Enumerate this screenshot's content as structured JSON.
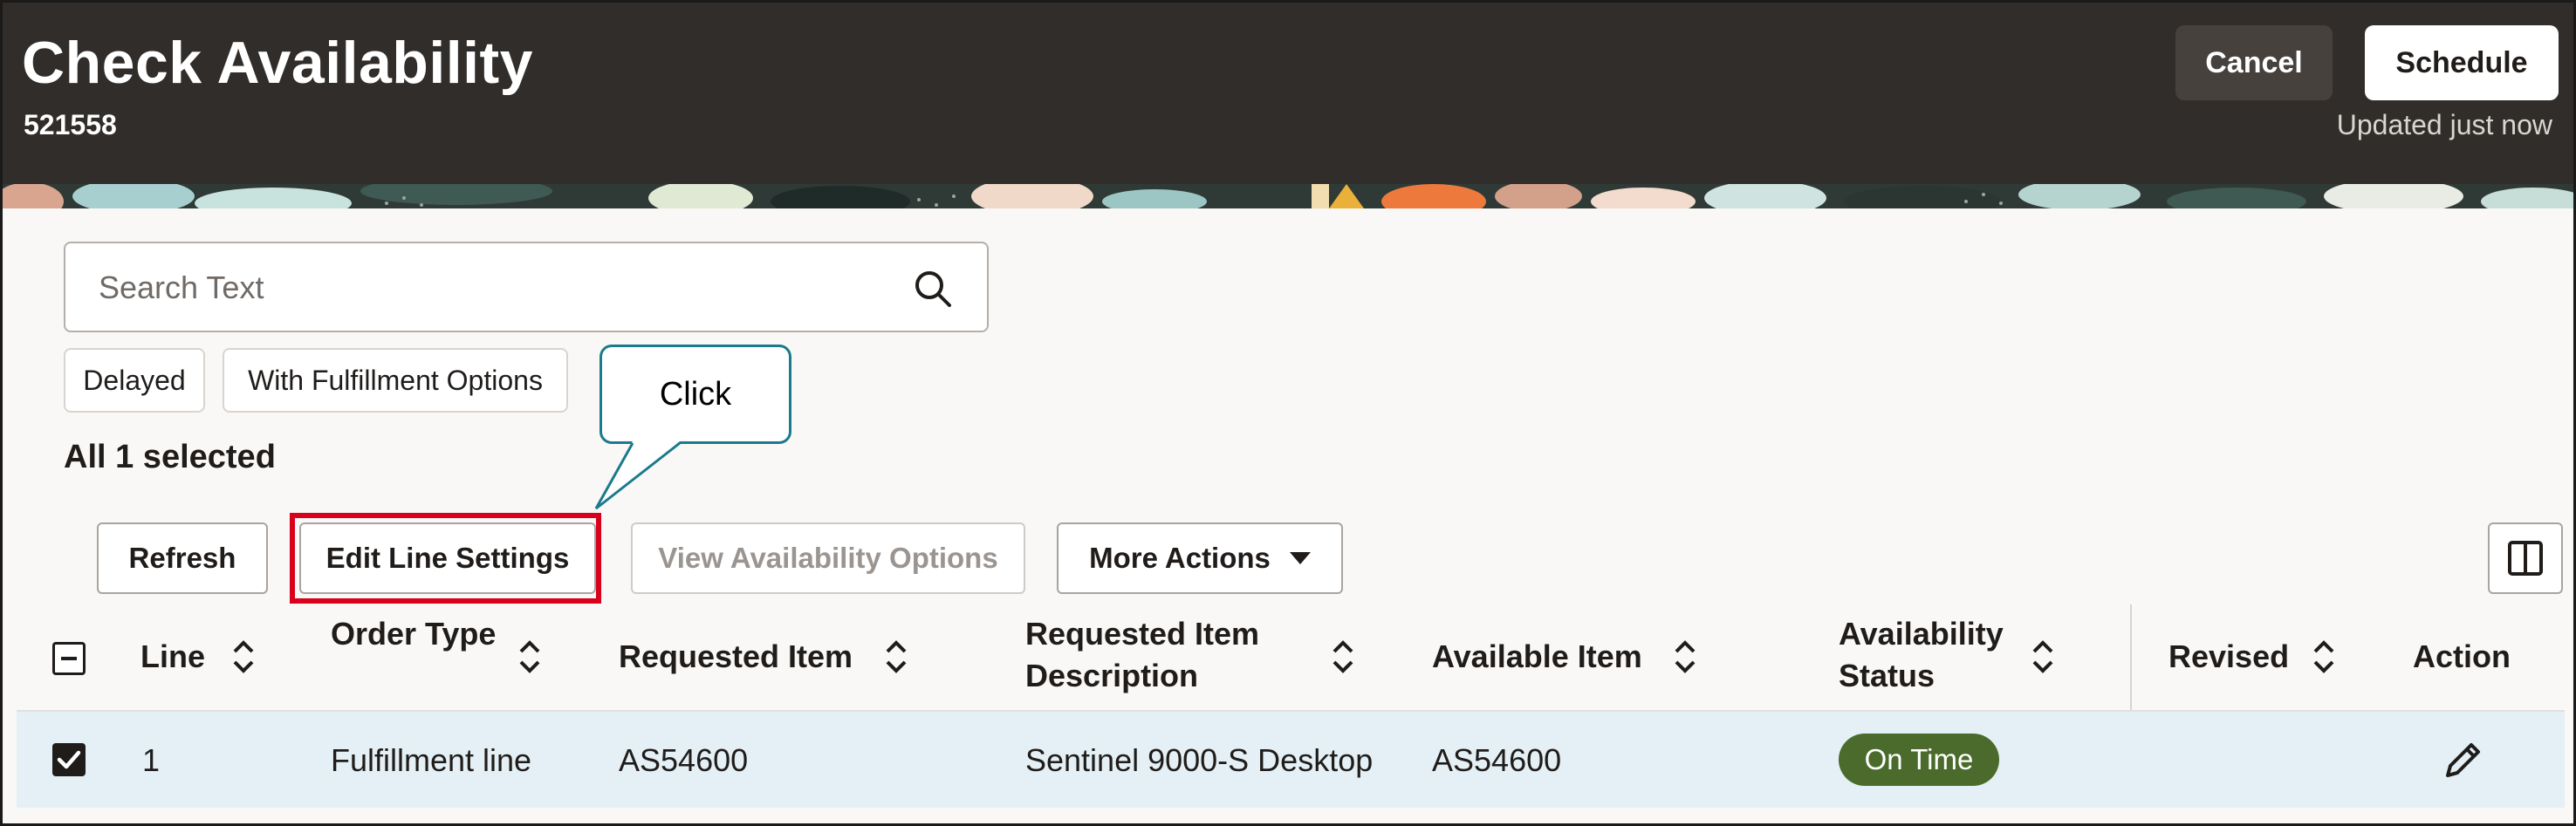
{
  "header": {
    "title": "Check Availability",
    "order_number": "521558",
    "cancel_label": "Cancel",
    "schedule_label": "Schedule",
    "updated_text": "Updated just now"
  },
  "search": {
    "placeholder": "Search Text",
    "icon": "search-icon"
  },
  "filters": [
    "Delayed",
    "With Fulfillment Options"
  ],
  "callout": {
    "text": "Click"
  },
  "selection_text": "All 1 selected",
  "toolbar": {
    "refresh_label": "Refresh",
    "edit_line_settings_label": "Edit Line Settings",
    "view_availability_label": "View Availability Options",
    "more_actions_label": "More Actions",
    "panel_icon": "split-panel-icon"
  },
  "table": {
    "columns": [
      {
        "key": "line",
        "label": "Line",
        "sortable": true
      },
      {
        "key": "order_type",
        "label": "Order Type",
        "sortable": true
      },
      {
        "key": "requested_item",
        "label": "Requested Item",
        "sortable": true
      },
      {
        "key": "requested_desc",
        "label": "Requested Item Description",
        "sortable": true
      },
      {
        "key": "available_item",
        "label": "Available Item",
        "sortable": true
      },
      {
        "key": "availability_status",
        "label": "Availability Status",
        "sortable": true
      },
      {
        "key": "revised",
        "label": "Revised",
        "sortable": true
      },
      {
        "key": "action",
        "label": "Action",
        "sortable": false
      }
    ],
    "rows": [
      {
        "selected": true,
        "line": "1",
        "order_type": "Fulfillment line",
        "requested_item": "AS54600",
        "requested_desc": "Sentinel 9000-S Desktop",
        "available_item": "AS54600",
        "availability_status": "On Time",
        "revised": "",
        "action_icon": "pencil-icon"
      }
    ]
  },
  "colors": {
    "header_bg": "#312d2a",
    "highlight": "#d9001b",
    "callout_border": "#1b7a8c",
    "status_on_time": "#4a6b2b",
    "selected_row": "#e4f0f5"
  }
}
